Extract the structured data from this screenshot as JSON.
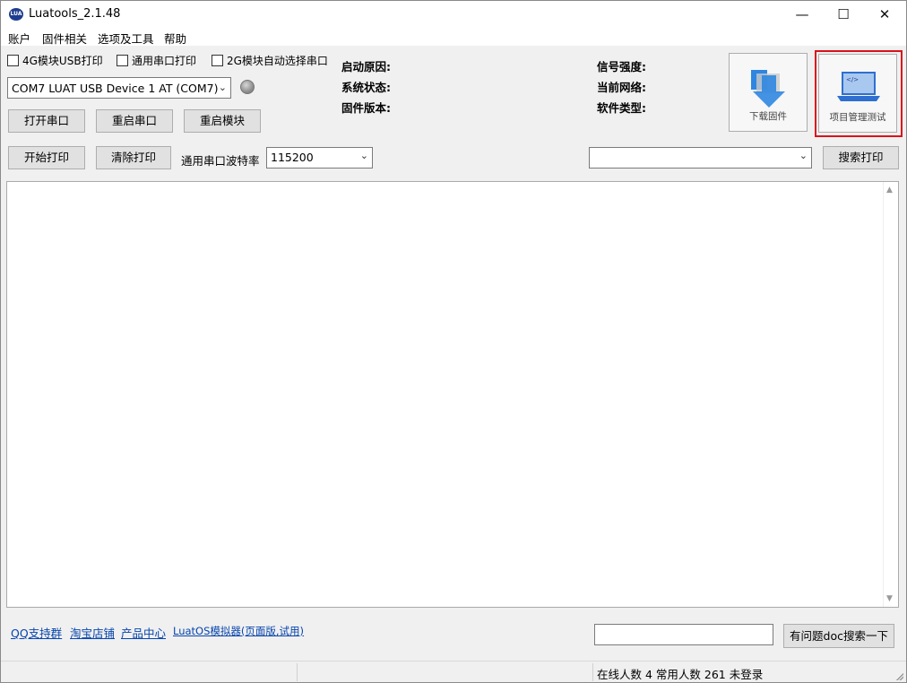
{
  "window": {
    "title": "Luatools_2.1.48",
    "icon_text": "LUA"
  },
  "window_controls": {
    "minimize": "—",
    "maximize": "☐",
    "close": "✕"
  },
  "menu": {
    "account": "账户",
    "firmware": "固件相关",
    "options": "选项及工具",
    "help": "帮助"
  },
  "options": {
    "usb_print_4g": "4G模块USB打印",
    "general_serial_print": "通用串口打印",
    "auto_select_2g": "2G模块自动选择串口"
  },
  "port_select": {
    "value": "COM7 LUAT USB Device 1 AT (COM7)"
  },
  "buttons": {
    "open_port": "打开串口",
    "restart_port": "重启串口",
    "restart_module": "重启模块",
    "start_print": "开始打印",
    "clear_print": "清除打印",
    "search_print": "搜索打印",
    "doc_search": "有问题doc搜索一下"
  },
  "baud": {
    "label": "通用串口波特率",
    "value": "115200"
  },
  "info": {
    "boot_reason": "启动原因:",
    "system_status": "系统状态:",
    "firmware_version": "固件版本:",
    "signal_strength": "信号强度:",
    "current_network": "当前网络:",
    "software_type": "软件类型:"
  },
  "big_buttons": {
    "download_firmware": "下载固件",
    "project_management": "项目管理测试",
    "code_glyph": "</>"
  },
  "search_select": {
    "value": ""
  },
  "doc_search_input": {
    "value": ""
  },
  "links": {
    "qq_group": "QQ支持群",
    "taobao": "淘宝店铺",
    "products": "产品中心",
    "simulator": "LuatOS模拟器(页面版,试用)"
  },
  "status": {
    "online": "在线人数 4 常用人数 261 未登录"
  },
  "colors": {
    "highlight": "#d9131b",
    "link": "#0645ad",
    "download_arrow": "#2f86e0"
  }
}
